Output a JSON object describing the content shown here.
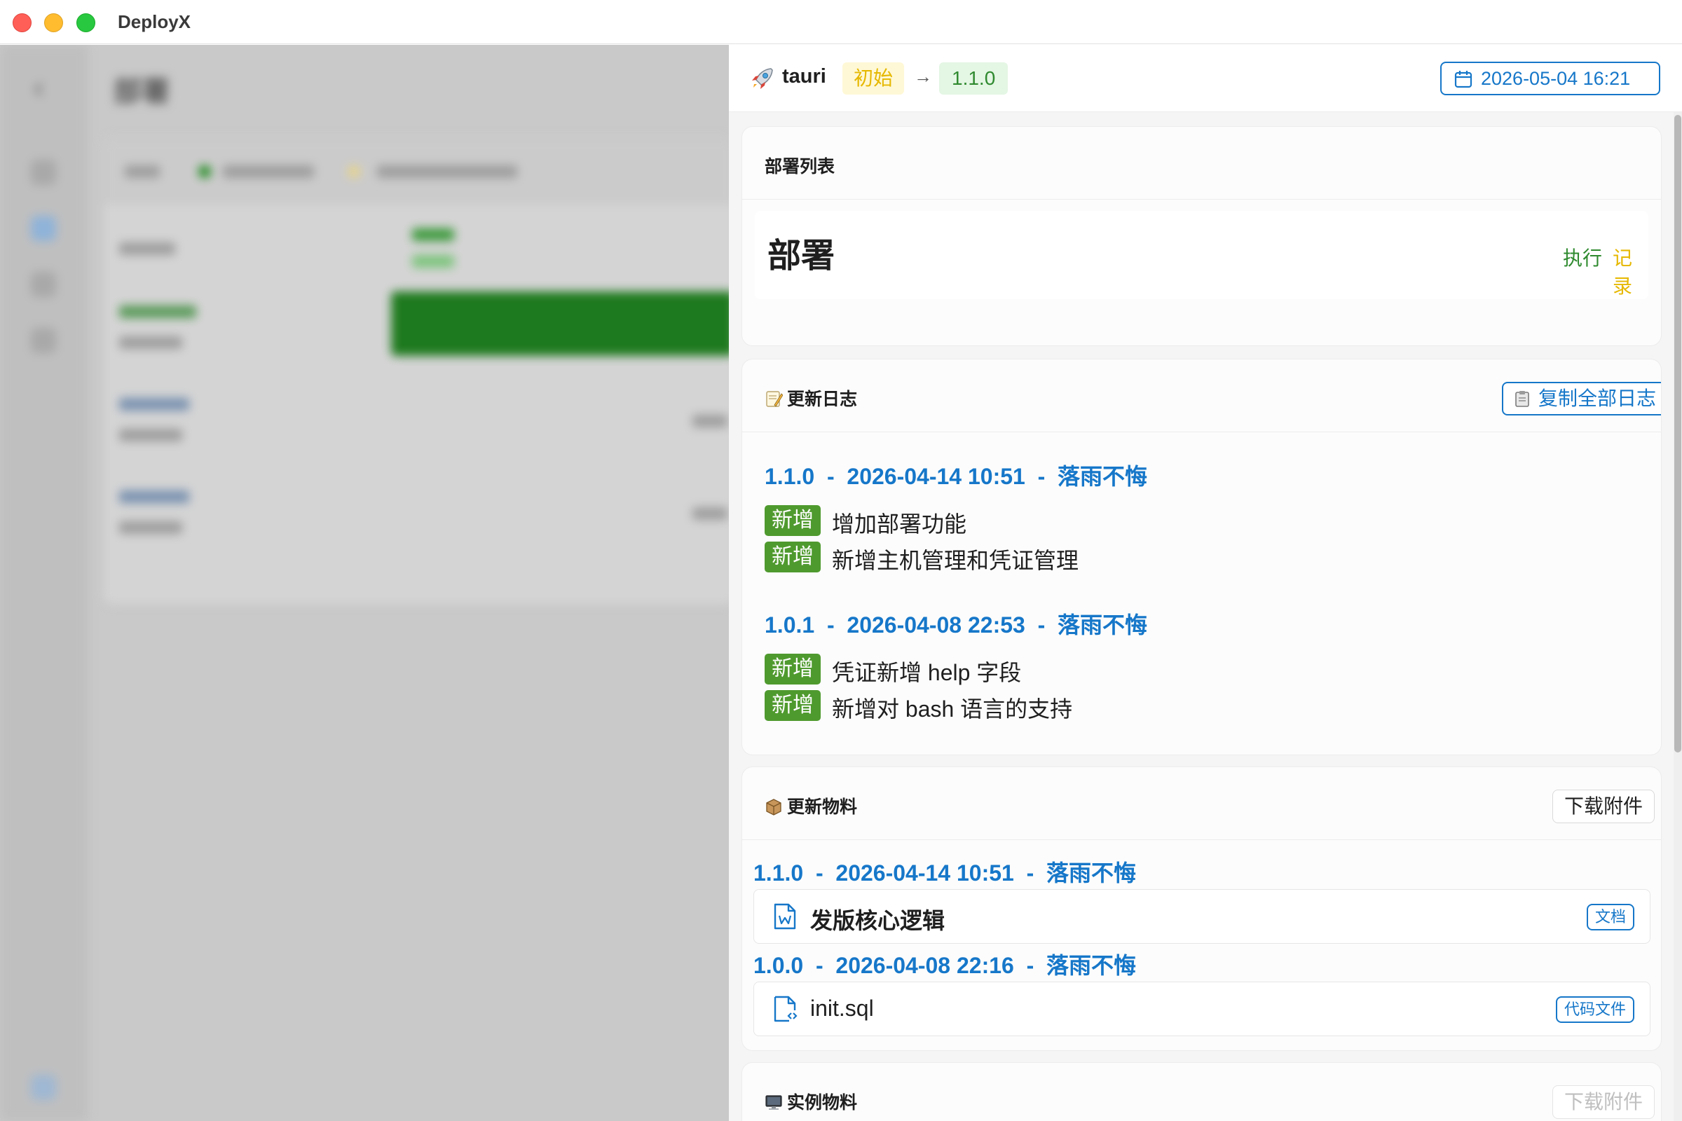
{
  "window": {
    "title": "DeployX"
  },
  "background": {
    "page_title": "部署"
  },
  "drawer": {
    "project": "tauri",
    "from_tag": "初始",
    "arrow": "→",
    "to_version": "1.1.0",
    "date": "2026-05-04 16:21",
    "deploy_list": {
      "title": "部署列表",
      "heading": "部署",
      "execute_label": "执行",
      "record_label": "记录"
    },
    "changelog": {
      "title": "更新日志",
      "copy_label": "复制全部日志",
      "versions": [
        {
          "header": "1.1.0  -  2026-04-14 10:51  -  落雨不悔",
          "entries": [
            {
              "badge": "新增",
              "text": "增加部署功能"
            },
            {
              "badge": "新增",
              "text": "新增主机管理和凭证管理"
            }
          ]
        },
        {
          "header": "1.0.1  -  2026-04-08 22:53  -  落雨不悔",
          "entries": [
            {
              "badge": "新增",
              "text": "凭证新增 help 字段"
            },
            {
              "badge": "新增",
              "text": "新增对 bash 语言的支持"
            }
          ]
        }
      ]
    },
    "materials": {
      "title": "更新物料",
      "download_label": "下载附件",
      "groups": [
        {
          "header": "1.1.0  -  2026-04-14 10:51  -  落雨不悔",
          "file": "发版核心逻辑",
          "tag": "文档",
          "icon": "word-doc-icon"
        },
        {
          "header": "1.0.0  -  2026-04-08 22:16  -  落雨不悔",
          "file": "init.sql",
          "tag": "代码文件",
          "icon": "code-file-icon"
        }
      ]
    },
    "instance_materials": {
      "title": "实例物料",
      "download_label": "下载附件"
    }
  },
  "colors": {
    "accent_blue": "#1677c9",
    "success_green": "#2f8a2f",
    "warning_yellow": "#e6b800",
    "badge_green": "#4f9a2e"
  }
}
